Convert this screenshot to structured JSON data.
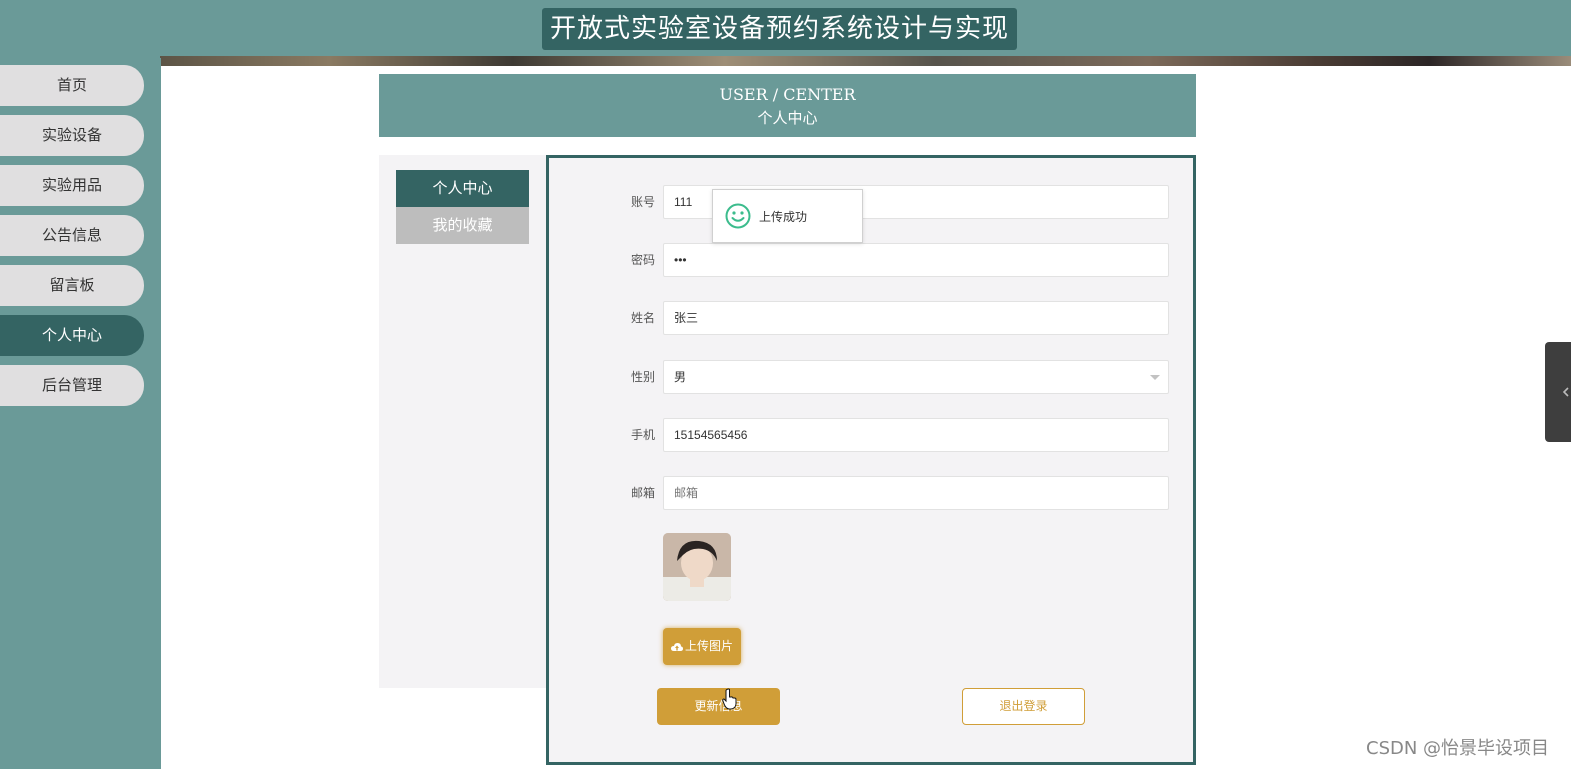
{
  "header": {
    "title": "开放式实验室设备预约系统设计与实现"
  },
  "sidebar": {
    "items": [
      {
        "label": "首页",
        "active": false
      },
      {
        "label": "实验设备",
        "active": false
      },
      {
        "label": "实验用品",
        "active": false
      },
      {
        "label": "公告信息",
        "active": false
      },
      {
        "label": "留言板",
        "active": false
      },
      {
        "label": "个人中心",
        "active": true
      },
      {
        "label": "后台管理",
        "active": false
      }
    ]
  },
  "user_center": {
    "title_en": "USER / CENTER",
    "title_cn": "个人中心",
    "submenu": [
      {
        "label": "个人中心",
        "active": true
      },
      {
        "label": "我的收藏",
        "active": false
      }
    ]
  },
  "form": {
    "account": {
      "label": "账号",
      "value": "111"
    },
    "password": {
      "label": "密码",
      "value": "•••"
    },
    "name": {
      "label": "姓名",
      "value": "张三"
    },
    "gender": {
      "label": "性别",
      "value": "男"
    },
    "phone": {
      "label": "手机",
      "value": "15154565456"
    },
    "email": {
      "label": "邮箱",
      "placeholder": "邮箱"
    },
    "upload_label": "上传图片",
    "update_label": "更新信息",
    "logout_label": "退出登录"
  },
  "toast": {
    "message": "上传成功"
  },
  "watermark": "CSDN @怡景毕设项目",
  "colors": {
    "teal": "#6a9a98",
    "dark_teal": "#346463",
    "gold": "#d09e38",
    "success_green": "#3cbc8d"
  }
}
